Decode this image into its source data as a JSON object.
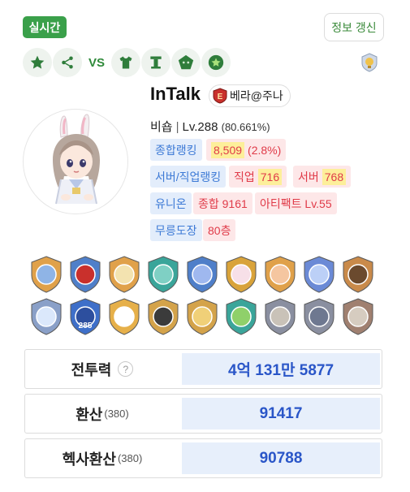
{
  "header": {
    "realtime_label": "실시간",
    "refresh_label": "정보 갱신",
    "vs_label": "VS"
  },
  "icons": [
    "star-icon",
    "share-icon",
    "vs-label",
    "equipment-shirt-icon",
    "pillar-icon",
    "guild-pentagon-icon",
    "star-circle-icon"
  ],
  "character": {
    "name": "InTalk",
    "server": "베라@주나",
    "job": "비숍",
    "separator": "|",
    "level": "Lv.288",
    "exp_percent": "(80.661%)"
  },
  "rankings": {
    "overall_label": "종합랭킹",
    "overall_value": "8,509",
    "overall_change": "(2.8%)",
    "server_job_label": "서버/직업랭킹",
    "job_label": "직업",
    "job_value": "716",
    "server_label": "서버",
    "server_value": "768",
    "union_label": "유니온",
    "union_total": "종합 9161",
    "artifact": "아티팩트 Lv.55",
    "dojo_label": "무릉도장",
    "dojo_value": "80층"
  },
  "medals": {
    "row1": [
      "medal-1",
      "medal-2",
      "medal-3",
      "medal-4",
      "medal-5",
      "medal-6",
      "medal-7",
      "medal-8",
      "medal-9"
    ],
    "row2": [
      "medal-10",
      "medal-11",
      "medal-12",
      "medal-13",
      "medal-14",
      "medal-15",
      "medal-16",
      "medal-17",
      "medal-18"
    ],
    "badge_number": "285"
  },
  "stats": {
    "power_label": "전투력",
    "power_help": "?",
    "power_value": "4억 131만 5877",
    "conversion_label": "환산",
    "conversion_sub": "(380)",
    "conversion_value": "91417",
    "hexa_label": "헥사환산",
    "hexa_sub": "(380)",
    "hexa_value": "90788"
  },
  "colors": {
    "accent_green": "#3aa04a",
    "value_blue": "#2a56c8",
    "rank_red": "#e03a48",
    "chip_blue": "#3d7ad6"
  }
}
